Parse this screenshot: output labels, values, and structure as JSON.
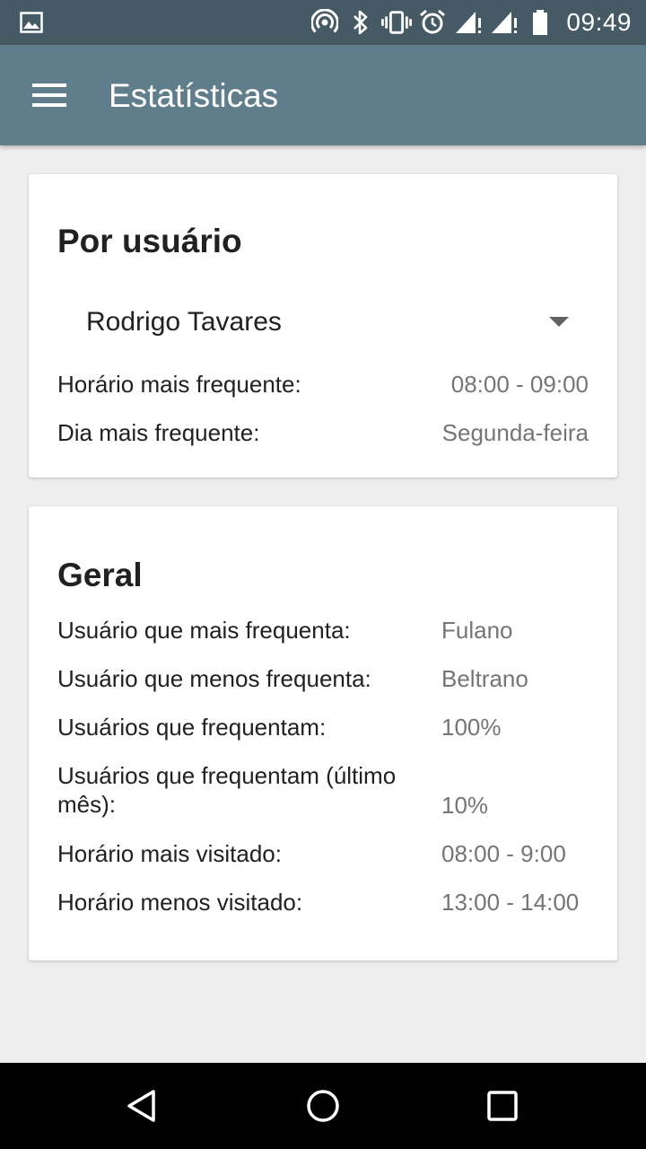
{
  "status_bar": {
    "time": "09:49",
    "icons": [
      "gallery-icon",
      "hotspot-icon",
      "bluetooth-icon",
      "vibrate-icon",
      "alarm-icon",
      "signal-icon",
      "signal-icon",
      "battery-icon"
    ]
  },
  "app_bar": {
    "title": "Estatísticas",
    "menu_icon": "hamburger-menu-icon"
  },
  "por_usuario": {
    "title": "Por usuário",
    "selected_user": "Rodrigo Tavares",
    "rows": [
      {
        "label": "Horário mais frequente:",
        "value": "08:00 - 09:00"
      },
      {
        "label": "Dia mais frequente:",
        "value": "Segunda-feira"
      }
    ]
  },
  "geral": {
    "title": "Geral",
    "rows": [
      {
        "label": "Usuário que mais frequenta:",
        "value": "Fulano"
      },
      {
        "label": "Usuário que menos frequenta:",
        "value": "Beltrano"
      },
      {
        "label": "Usuários que frequentam:",
        "value": "100%"
      },
      {
        "label": "Usuários que frequentam (último mês):",
        "value": "10%"
      },
      {
        "label": "Horário mais visitado:",
        "value": "08:00 - 9:00"
      },
      {
        "label": "Horário menos visitado:",
        "value": "13:00 - 14:00"
      }
    ]
  },
  "nav_bar": {
    "icons": [
      "back-icon",
      "home-icon",
      "recents-icon"
    ]
  },
  "colors": {
    "status_bar": "#455a64",
    "app_bar": "#607d8b",
    "background": "#eeeeee",
    "card": "#ffffff"
  }
}
